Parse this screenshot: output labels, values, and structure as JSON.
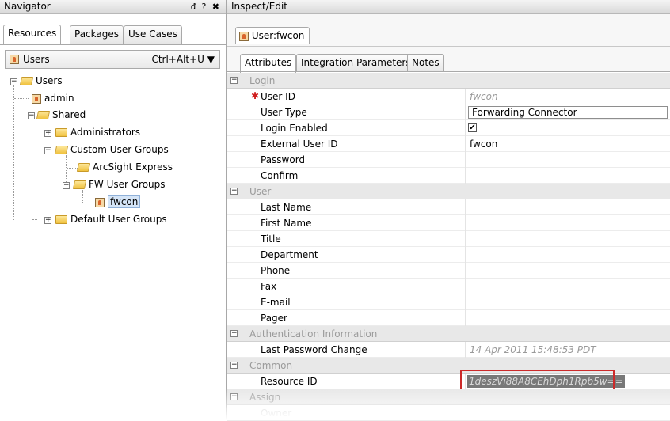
{
  "navigator": {
    "title": "Navigator",
    "controls": "ᵭ ? ✖",
    "tabs": [
      "Resources",
      "Packages",
      "Use Cases"
    ],
    "resource_selector": {
      "label": "Users",
      "shortcut": "Ctrl+Alt+U ▼"
    },
    "tree": {
      "root": "Users",
      "admin": "admin",
      "shared": "Shared",
      "administrators": "Administrators",
      "custom_user_groups": "Custom User Groups",
      "arcsight_express": "ArcSight Express",
      "fw_user_groups": "FW User Groups",
      "fwcon": "fwcon",
      "default_user_groups": "Default User Groups"
    }
  },
  "inspect": {
    "title": "Inspect/Edit",
    "document_tab": "User:fwcon",
    "inner_tabs": [
      "Attributes",
      "Integration Parameters",
      "Notes"
    ],
    "sections": {
      "login": "Login",
      "user": "User",
      "auth": "Authentication Information",
      "common": "Common",
      "assign": "Assign"
    },
    "fields": {
      "user_id": {
        "label": "User ID",
        "value": "fwcon"
      },
      "user_type": {
        "label": "User Type",
        "value": "Forwarding Connector"
      },
      "login_enabled": {
        "label": "Login Enabled",
        "checked": "✔"
      },
      "external_user_id": {
        "label": "External User ID",
        "value": "fwcon"
      },
      "password": {
        "label": "Password"
      },
      "confirm": {
        "label": "Confirm"
      },
      "last_name": {
        "label": "Last Name"
      },
      "first_name": {
        "label": "First Name"
      },
      "title": {
        "label": "Title"
      },
      "department": {
        "label": "Department"
      },
      "phone": {
        "label": "Phone"
      },
      "fax": {
        "label": "Fax"
      },
      "email": {
        "label": "E-mail"
      },
      "pager": {
        "label": "Pager"
      },
      "last_password_change": {
        "label": "Last Password Change",
        "value": "14 Apr 2011 15:48:53 PDT"
      },
      "resource_id": {
        "label": "Resource ID",
        "value": "1deszVi88A8CEhDph1Rpb5w=="
      },
      "owner": {
        "label": "Owner"
      }
    }
  },
  "colors": {
    "highlight_border": "#cc2a2a",
    "section_bg": "#e8e8e8",
    "selection": "#d5e5f7"
  }
}
